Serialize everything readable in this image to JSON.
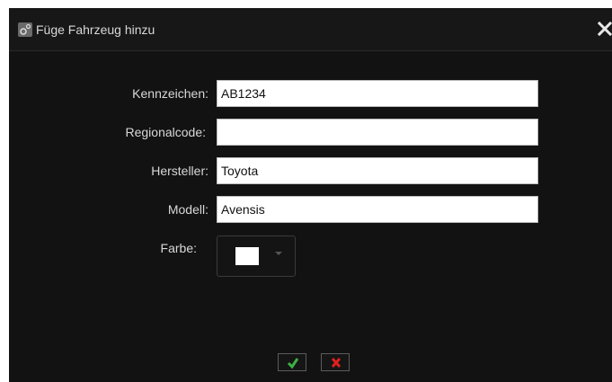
{
  "dialog": {
    "title": "Füge Fahrzeug hinzu"
  },
  "form": {
    "license_plate": {
      "label": "Kennzeichen:",
      "value": "AB1234"
    },
    "regional_code": {
      "label": "Regionalcode:",
      "value": ""
    },
    "manufacturer": {
      "label": "Hersteller:",
      "value": "Toyota"
    },
    "model": {
      "label": "Modell:",
      "value": "Avensis"
    },
    "color": {
      "label": "Farbe:",
      "selected": "#ffffff"
    }
  },
  "icons": {
    "title": "settings-icon",
    "close": "close-icon",
    "confirm": "checkmark-icon",
    "cancel": "cross-icon"
  },
  "colors": {
    "confirm": "#3cb043",
    "cancel": "#e02020"
  }
}
